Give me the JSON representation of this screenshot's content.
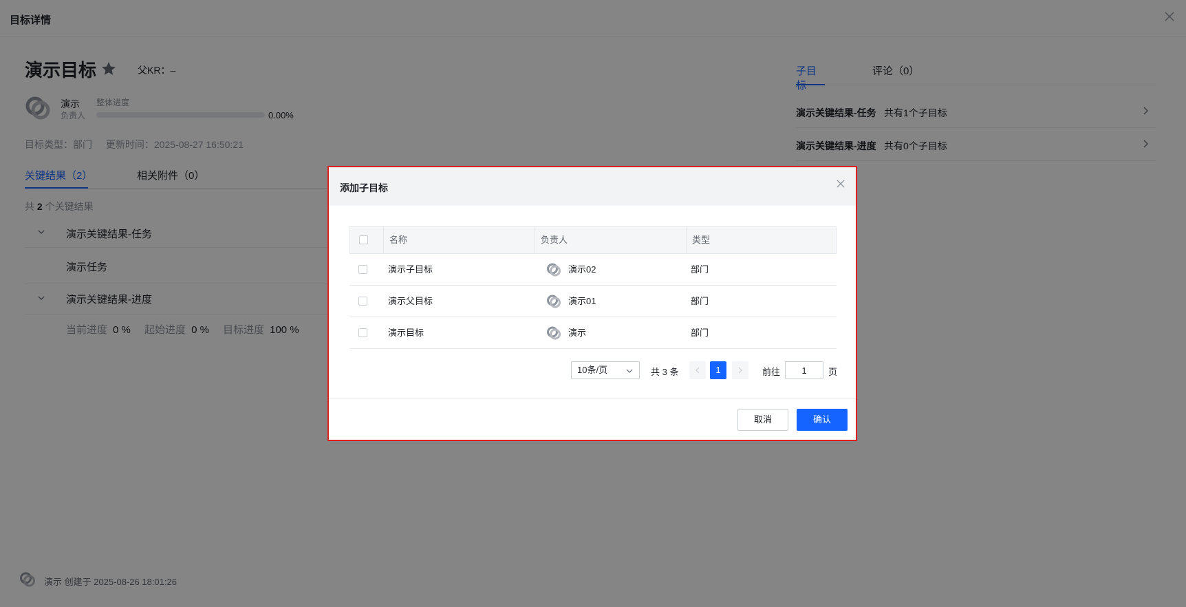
{
  "header": {
    "title": "目标详情"
  },
  "objective": {
    "title": "演示目标",
    "parent_kr": "父KR：–",
    "owner_name": "演示",
    "owner_role": "负责人",
    "progress_label": "整体进度",
    "progress_value": "0.00%",
    "progress_fraction": 0.0,
    "type_text": "目标类型：部门",
    "updated_text": "更新时间：2025-08-27 16:50:21"
  },
  "left_tabs": [
    {
      "label": "关键结果（2）"
    },
    {
      "label": "相关附件（0）"
    }
  ],
  "kr_summary": {
    "prefix": "共",
    "count": "2",
    "suffix": "个关键结果"
  },
  "key_results": [
    {
      "label": "演示关键结果-任务"
    },
    {
      "label": "演示任务"
    },
    {
      "label": "演示关键结果-进度"
    }
  ],
  "kr_progress": {
    "current_label": "当前进度",
    "current_value": "0 %",
    "start_label": "起始进度",
    "start_value": "0 %",
    "target_label": "目标进度",
    "target_value": "100 %"
  },
  "right_tabs": [
    {
      "label": "子目标"
    },
    {
      "label": "评论（0）"
    }
  ],
  "sub_targets": [
    {
      "name": "演示关键结果-任务",
      "count": "共有1个子目标"
    },
    {
      "name": "演示关键结果-进度",
      "count": "共有0个子目标"
    }
  ],
  "footer": {
    "text": "演示 创建于 2025-08-26 18:01:26"
  },
  "modal": {
    "title": "添加子目标",
    "columns": [
      "名称",
      "负责人",
      "类型"
    ],
    "rows": [
      {
        "name": "演示子目标",
        "owner": "演示02",
        "type": "部门"
      },
      {
        "name": "演示父目标",
        "owner": "演示01",
        "type": "部门"
      },
      {
        "name": "演示目标",
        "owner": "演示",
        "type": "部门"
      }
    ],
    "pagination": {
      "page_size": "10条/页",
      "total": "共 3 条",
      "current_page": "1",
      "goto_label": "前往",
      "goto_value": "1",
      "goto_suffix": "页"
    },
    "cancel_label": "取消",
    "confirm_label": "确认"
  },
  "colors": {
    "accent": "#1664ff",
    "highlight_border": "#e02020"
  },
  "icons": [
    "close-icon",
    "star-icon",
    "chevron-down-icon",
    "chevron-right-icon",
    "chevron-left-icon",
    "avatar-icon"
  ]
}
